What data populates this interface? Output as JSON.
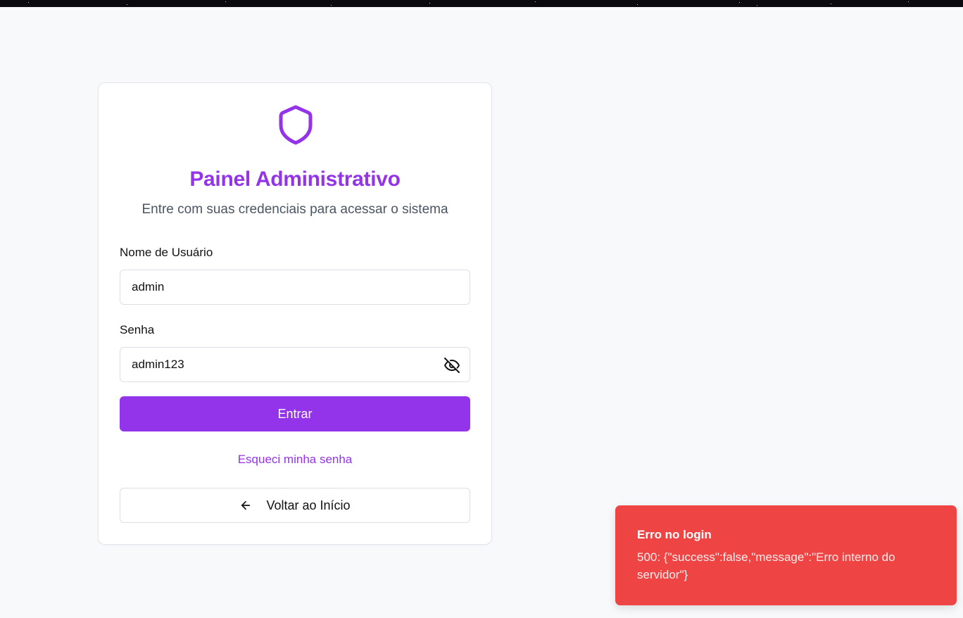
{
  "login": {
    "title": "Painel Administrativo",
    "subtitle": "Entre com suas credenciais para acessar o sistema",
    "username_label": "Nome de Usuário",
    "username_value": "admin",
    "password_label": "Senha",
    "password_value": "admin123",
    "submit_label": "Entrar",
    "forgot_label": "Esqueci minha senha",
    "back_label": "Voltar ao Início"
  },
  "toast": {
    "title": "Erro no login",
    "message": "500: {\"success\":false,\"message\":\"Erro interno do servidor\"}"
  },
  "icons": {
    "logo": "shield-icon",
    "password_toggle": "eye-off-icon",
    "back": "arrow-left-icon"
  },
  "colors": {
    "accent": "#9333ea",
    "error": "#ef4444",
    "background": "#f8f9fb"
  }
}
